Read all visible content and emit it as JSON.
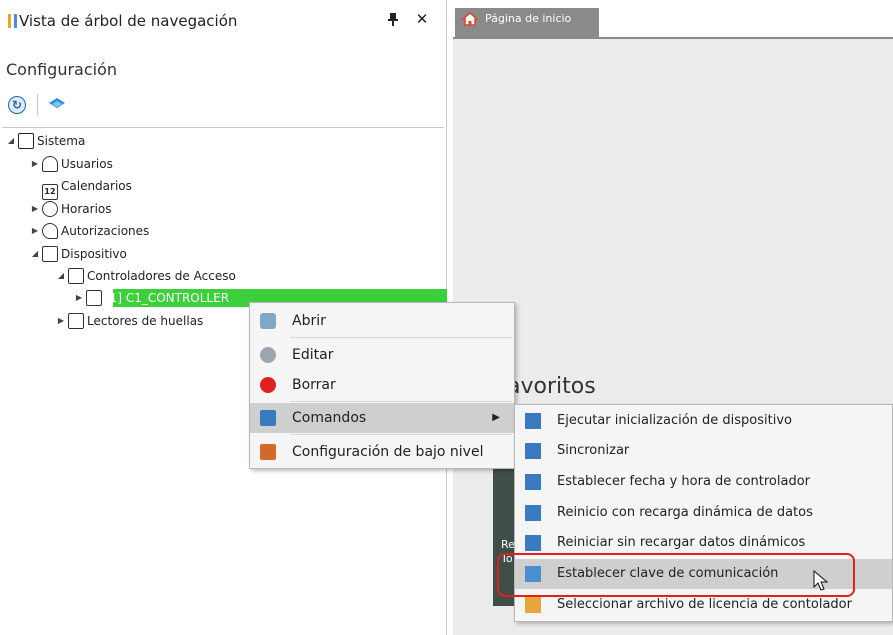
{
  "left_panel": {
    "title": "Vista de árbol de navegación",
    "section": "Configuración"
  },
  "tree": {
    "items": [
      {
        "label": "Sistema",
        "icon": "system-icon",
        "arrow": "◢"
      },
      {
        "label": "Usuarios",
        "icon": "user-icon",
        "arrow": "▶"
      },
      {
        "label": "Calendarios",
        "icon": "calendar-icon",
        "arrow": "",
        "icon_text": "12"
      },
      {
        "label": "Horarios",
        "icon": "clock-icon",
        "arrow": "▶"
      },
      {
        "label": "Autorizaciones",
        "icon": "key-icon",
        "arrow": "▶"
      },
      {
        "label": "Dispositivo",
        "icon": "device-icon",
        "arrow": "◢"
      },
      {
        "label": "Controladores de Acceso",
        "icon": "controller-icon",
        "arrow": "◢"
      },
      {
        "label": "[1] C1_CONTROLLER",
        "icon": "controller-icon",
        "arrow": "▶"
      },
      {
        "label": "Lectores de huellas",
        "icon": "fingerprint-icon",
        "arrow": "▶"
      }
    ],
    "selected_color": "#3cd13c"
  },
  "tabs": {
    "home": "Página de inicio"
  },
  "content": {
    "favoritos": "avoritos",
    "tile_text": "Re\nTo"
  },
  "context_menu": {
    "items": [
      {
        "label": "Abrir",
        "icon": "open-icon"
      },
      {
        "label": "Editar",
        "icon": "edit-icon"
      },
      {
        "label": "Borrar",
        "icon": "delete-icon"
      },
      {
        "label": "Comandos",
        "icon": "commands-icon"
      },
      {
        "label": "Configuración de bajo nivel",
        "icon": "low-level-config-icon"
      }
    ]
  },
  "submenu": {
    "items": [
      {
        "label": "Ejecutar inicialización de dispositivo",
        "icon": "init-device-icon"
      },
      {
        "label": "Sincronizar",
        "icon": "sync-icon"
      },
      {
        "label": "Establecer fecha y hora de controlador",
        "icon": "datetime-icon"
      },
      {
        "label": "Reinicio con recarga dinámica de datos",
        "icon": "restart-reload-icon"
      },
      {
        "label": "Reiniciar sin recargar datos dinámicos",
        "icon": "restart-icon"
      },
      {
        "label": "Establecer clave de comunicación",
        "icon": "comm-key-icon"
      },
      {
        "label": "Seleccionar archivo de licencia de contolador",
        "icon": "license-file-icon"
      }
    ]
  },
  "colors": {
    "accent_green": "#3cd13c",
    "highlight_red": "#e02020",
    "tab_gray": "#8a8a8a"
  }
}
